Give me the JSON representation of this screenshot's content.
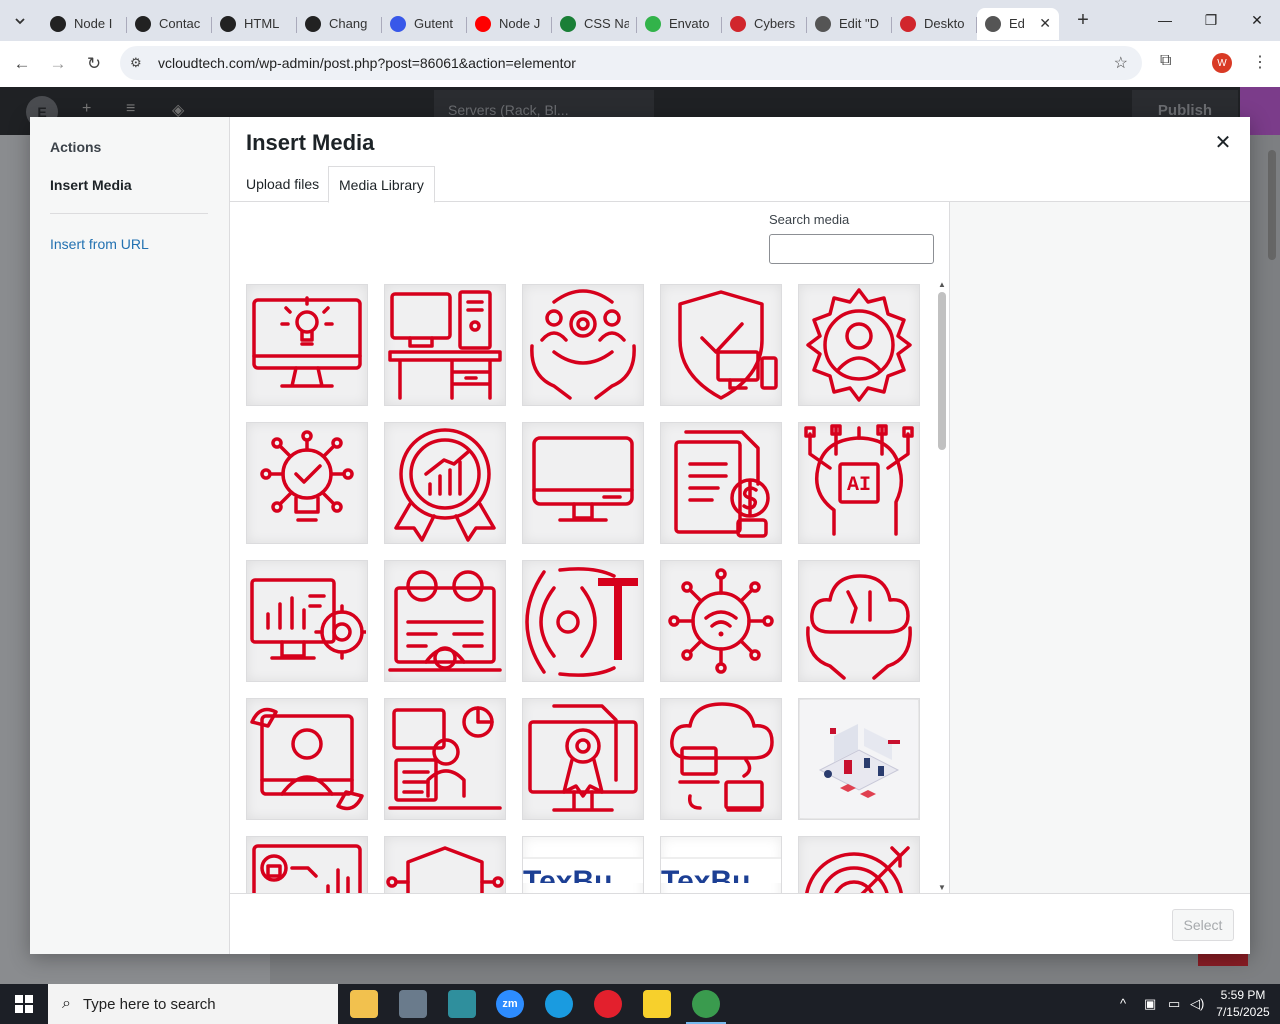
{
  "browser": {
    "tabs": [
      {
        "label": "Node I",
        "color": "#222222"
      },
      {
        "label": "Contac",
        "color": "#222222"
      },
      {
        "label": "HTML",
        "color": "#222222"
      },
      {
        "label": "Chang",
        "color": "#222222"
      },
      {
        "label": "Gutent",
        "color": "#3858e9"
      },
      {
        "label": "Node J",
        "color": "#ff0000"
      },
      {
        "label": "CSS Na",
        "color": "#1a7f37"
      },
      {
        "label": "Envato",
        "color": "#32b34a"
      },
      {
        "label": "Cybers",
        "color": "#d1262c"
      },
      {
        "label": "Edit \"D",
        "color": "#555555"
      },
      {
        "label": "Deskto",
        "color": "#d1262c"
      }
    ],
    "active_tab": {
      "label": "Ed"
    },
    "url": "vcloudtech.com/wp-admin/post.php?post=86061&action=elementor",
    "profile_initial": "W"
  },
  "editor": {
    "page_title": "Servers (Rack, Bl...",
    "publish_label": "Publish"
  },
  "modal": {
    "menu_heading": "Actions",
    "menu_items": [
      {
        "label": "Insert Media"
      },
      {
        "label": "Insert from URL"
      }
    ],
    "title": "Insert Media",
    "tabs": [
      {
        "label": "Upload files"
      },
      {
        "label": "Media Library"
      }
    ],
    "search_label": "Search media",
    "search_value": "",
    "select_label": "Select",
    "media_items": [
      {
        "icon": "monitor-lightbulb"
      },
      {
        "icon": "desk-computer"
      },
      {
        "icon": "hands-people-gear"
      },
      {
        "icon": "shield-devices"
      },
      {
        "icon": "gear-person"
      },
      {
        "icon": "lightbulb-network"
      },
      {
        "icon": "badge-chart"
      },
      {
        "icon": "monitor"
      },
      {
        "icon": "documents-dollar"
      },
      {
        "icon": "ai-head"
      },
      {
        "icon": "chart-gear-monitor"
      },
      {
        "icon": "gear-board"
      },
      {
        "icon": "iot"
      },
      {
        "icon": "wifi-network"
      },
      {
        "icon": "cloud-hands-tools"
      },
      {
        "icon": "person-wrench"
      },
      {
        "icon": "support-agent"
      },
      {
        "icon": "certificate-monitor"
      },
      {
        "icon": "cloud-transfer"
      },
      {
        "icon": "isometric-illustration"
      },
      {
        "icon": "lock-dashboard"
      },
      {
        "icon": "shield-network"
      },
      {
        "icon": "texbu-logo",
        "text": "TexBu"
      },
      {
        "icon": "texbu-logo",
        "text": "TexBu"
      },
      {
        "icon": "target-arrow"
      }
    ]
  },
  "taskbar": {
    "search_placeholder": "Type here to search",
    "time": "5:59 PM",
    "date": "7/15/2025"
  },
  "colors": {
    "icon_red": "#d6001c",
    "link_blue": "#2271b1"
  }
}
